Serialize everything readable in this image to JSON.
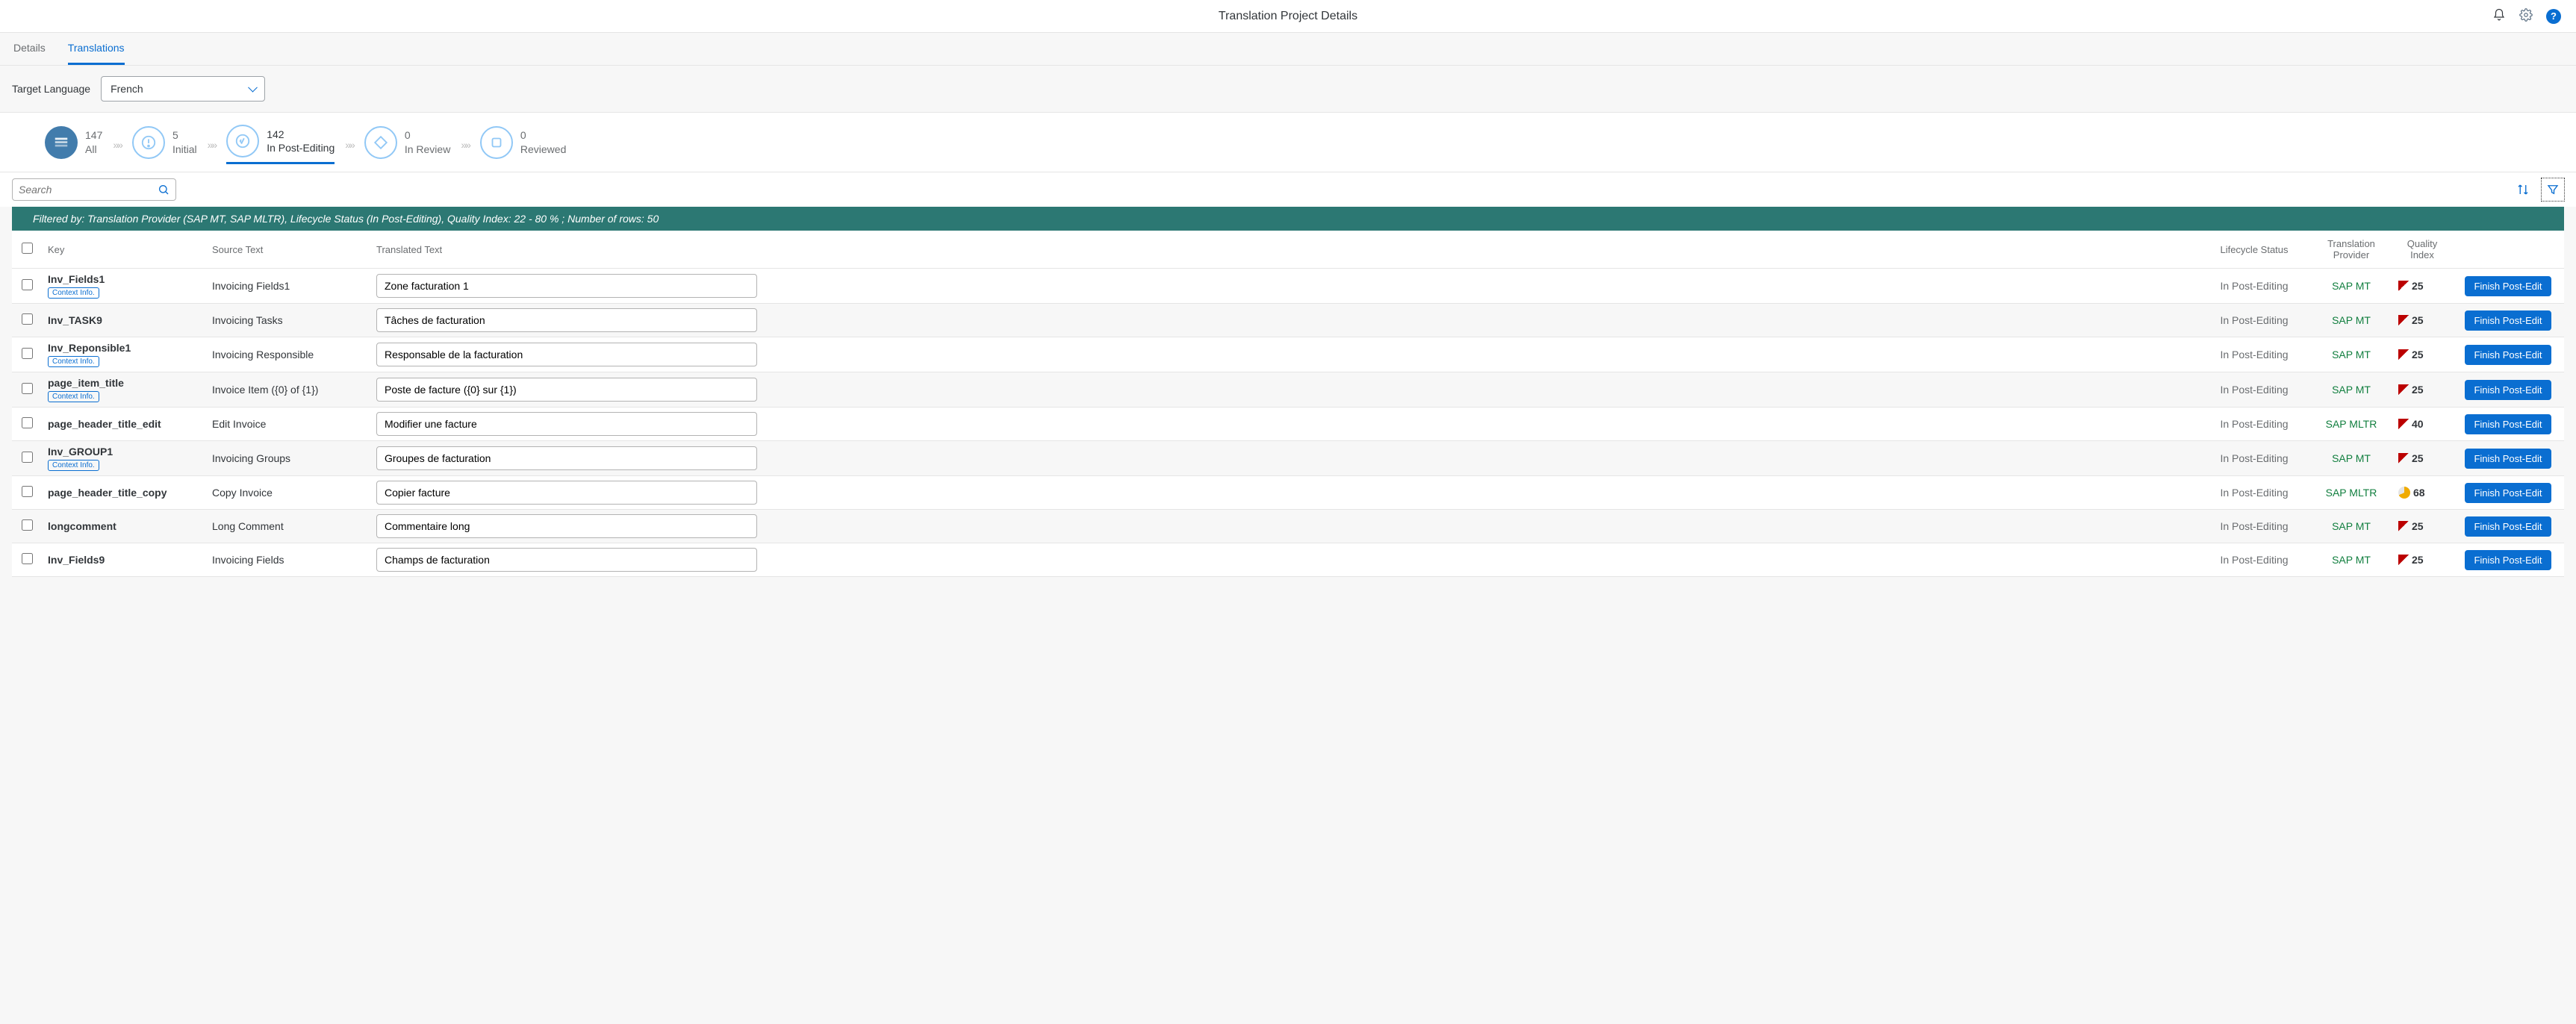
{
  "header": {
    "title": "Translation Project Details"
  },
  "tabs": {
    "details": "Details",
    "translations": "Translations"
  },
  "target_language": {
    "label": "Target Language",
    "selected": "French"
  },
  "steps": {
    "all": {
      "count": "147",
      "label": "All"
    },
    "initial": {
      "count": "5",
      "label": "Initial"
    },
    "post_editing": {
      "count": "142",
      "label": "In Post-Editing"
    },
    "in_review": {
      "count": "0",
      "label": "In Review"
    },
    "reviewed": {
      "count": "0",
      "label": "Reviewed"
    }
  },
  "search": {
    "placeholder": "Search"
  },
  "filter_banner": "Filtered by: Translation Provider (SAP MT, SAP MLTR), Lifecycle Status (In Post-Editing), Quality Index: 22 - 80 % ; Number of rows: 50",
  "columns": {
    "key": "Key",
    "source": "Source Text",
    "translated": "Translated Text",
    "status": "Lifecycle Status",
    "provider": "Translation Provider",
    "quality": "Quality Index"
  },
  "action_label": "Finish Post-Edit",
  "context_label": "Context Info.",
  "rows": [
    {
      "key": "Inv_Fields1",
      "context": true,
      "source": "Invoicing Fields1",
      "translated": "Zone facturation 1",
      "status": "In Post-Editing",
      "provider": "SAP MT",
      "quality": "25",
      "flag": "red"
    },
    {
      "key": "Inv_TASK9",
      "context": false,
      "source": "Invoicing Tasks",
      "translated": "Tâches de facturation",
      "status": "In Post-Editing",
      "provider": "SAP MT",
      "quality": "25",
      "flag": "red"
    },
    {
      "key": "Inv_Reponsible1",
      "context": true,
      "source": "Invoicing Responsible",
      "translated": "Responsable de la facturation",
      "status": "In Post-Editing",
      "provider": "SAP MT",
      "quality": "25",
      "flag": "red"
    },
    {
      "key": "page_item_title",
      "context": true,
      "source": "Invoice Item ({0} of {1})",
      "translated": "Poste de facture ({0} sur {1})",
      "status": "In Post-Editing",
      "provider": "SAP MT",
      "quality": "25",
      "flag": "red"
    },
    {
      "key": "page_header_title_edit",
      "context": false,
      "source": "Edit Invoice",
      "translated": "Modifier une facture",
      "status": "In Post-Editing",
      "provider": "SAP MLTR",
      "quality": "40",
      "flag": "red"
    },
    {
      "key": "Inv_GROUP1",
      "context": true,
      "source": "Invoicing Groups",
      "translated": "Groupes de facturation",
      "status": "In Post-Editing",
      "provider": "SAP MT",
      "quality": "25",
      "flag": "red"
    },
    {
      "key": "page_header_title_copy",
      "context": false,
      "source": "Copy Invoice",
      "translated": "Copier facture",
      "status": "In Post-Editing",
      "provider": "SAP MLTR",
      "quality": "68",
      "flag": "yellow"
    },
    {
      "key": "longcomment",
      "context": false,
      "source": "Long Comment",
      "translated": "Commentaire long",
      "status": "In Post-Editing",
      "provider": "SAP MT",
      "quality": "25",
      "flag": "red"
    },
    {
      "key": "Inv_Fields9",
      "context": false,
      "source": "Invoicing Fields",
      "translated": "Champs de facturation",
      "status": "In Post-Editing",
      "provider": "SAP MT",
      "quality": "25",
      "flag": "red"
    }
  ]
}
